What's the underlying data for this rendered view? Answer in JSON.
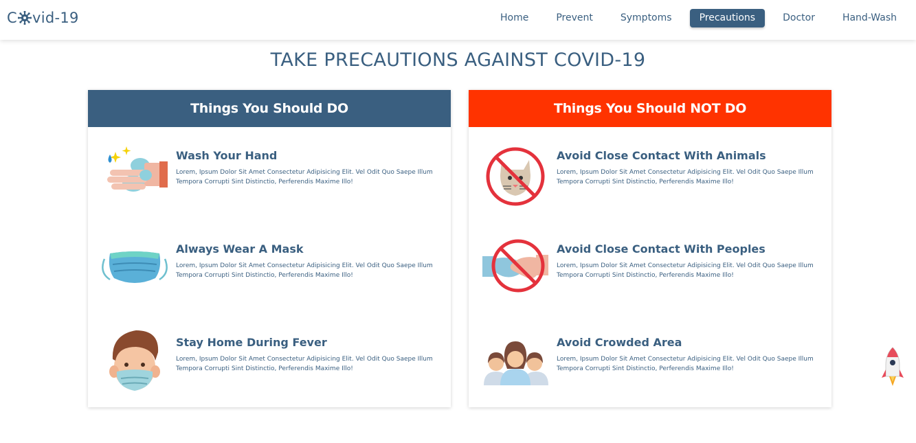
{
  "brand": {
    "prefix": "C",
    "suffix": "vid-19"
  },
  "nav": {
    "items": [
      {
        "label": "Home",
        "active": false
      },
      {
        "label": "Prevent",
        "active": false
      },
      {
        "label": "Symptoms",
        "active": false
      },
      {
        "label": "Precautions",
        "active": true
      },
      {
        "label": "Doctor",
        "active": false
      },
      {
        "label": "Hand-Wash",
        "active": false
      }
    ]
  },
  "page": {
    "title": "TAKE PRECAUTIONS AGAINST COVID-19"
  },
  "colors": {
    "primary": "#3a5f80",
    "danger": "#ff3300"
  },
  "do_panel": {
    "header": "Things You Should DO",
    "items": [
      {
        "title": "Wash Your Hand",
        "icon": "hand-wash-icon",
        "description": "Lorem, Ipsum Dolor Sit Amet Consectetur Adipisicing Elit. Vel Odit Quo Saepe Illum Tempora Corrupti Sint Distinctio, Perferendis Maxime Illo!"
      },
      {
        "title": "Always Wear A Mask",
        "icon": "face-mask-icon",
        "description": "Lorem, Ipsum Dolor Sit Amet Consectetur Adipisicing Elit. Vel Odit Quo Saepe Illum Tempora Corrupti Sint Distinctio, Perferendis Maxime Illo!"
      },
      {
        "title": "Stay Home During Fever",
        "icon": "masked-person-icon",
        "description": "Lorem, Ipsum Dolor Sit Amet Consectetur Adipisicing Elit. Vel Odit Quo Saepe Illum Tempora Corrupti Sint Distinctio, Perferendis Maxime Illo!"
      }
    ]
  },
  "dont_panel": {
    "header": "Things You Should NOT DO",
    "items": [
      {
        "title": "Avoid Close Contact With Animals",
        "icon": "no-animals-icon",
        "description": "Lorem, Ipsum Dolor Sit Amet Consectetur Adipisicing Elit. Vel Odit Quo Saepe Illum Tempora Corrupti Sint Distinctio, Perferendis Maxime Illo!"
      },
      {
        "title": "Avoid Close Contact With Peoples",
        "icon": "no-handshake-icon",
        "description": "Lorem, Ipsum Dolor Sit Amet Consectetur Adipisicing Elit. Vel Odit Quo Saepe Illum Tempora Corrupti Sint Distinctio, Perferendis Maxime Illo!"
      },
      {
        "title": "Avoid Crowded Area",
        "icon": "crowd-icon",
        "description": "Lorem, Ipsum Dolor Sit Amet Consectetur Adipisicing Elit. Vel Odit Quo Saepe Illum Tempora Corrupti Sint Distinctio, Perferendis Maxime Illo!"
      }
    ]
  },
  "scroll_top": {
    "icon": "rocket-icon"
  }
}
